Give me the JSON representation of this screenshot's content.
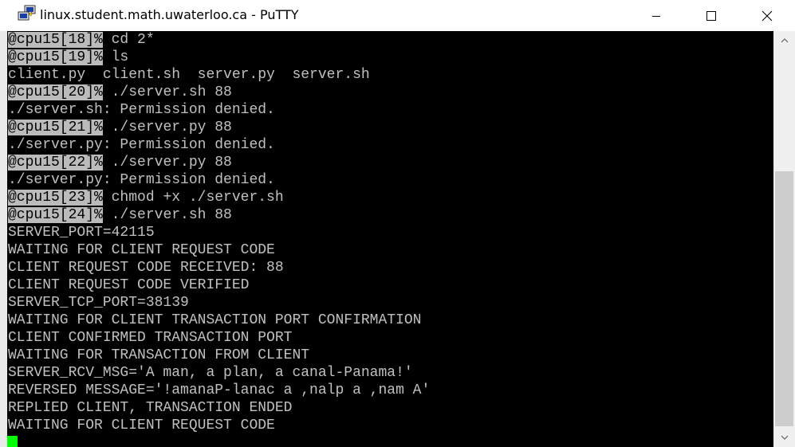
{
  "window": {
    "title": "linux.student.math.uwaterloo.ca - PuTTY",
    "icon": "putty-icon"
  },
  "terminal": {
    "lines": [
      {
        "prompt": "@cpu15[18]%",
        "text": " cd 2*"
      },
      {
        "prompt": "@cpu15[19]%",
        "text": " ls"
      },
      {
        "prompt": "",
        "text": "client.py  client.sh  server.py  server.sh"
      },
      {
        "prompt": "@cpu15[20]%",
        "text": " ./server.sh 88"
      },
      {
        "prompt": "",
        "text": "./server.sh: Permission denied."
      },
      {
        "prompt": "@cpu15[21]%",
        "text": " ./server.py 88"
      },
      {
        "prompt": "",
        "text": "./server.py: Permission denied."
      },
      {
        "prompt": "@cpu15[22]%",
        "text": " ./server.py 88"
      },
      {
        "prompt": "",
        "text": "./server.py: Permission denied."
      },
      {
        "prompt": "@cpu15[23]%",
        "text": " chmod +x ./server.sh"
      },
      {
        "prompt": "@cpu15[24]%",
        "text": " ./server.sh 88"
      },
      {
        "prompt": "",
        "text": "SERVER_PORT=42115"
      },
      {
        "prompt": "",
        "text": "WAITING FOR CLIENT REQUEST CODE"
      },
      {
        "prompt": "",
        "text": "CLIENT REQUEST CODE RECEIVED: 88"
      },
      {
        "prompt": "",
        "text": "CLIENT REQUEST CODE VERIFIED"
      },
      {
        "prompt": "",
        "text": "SERVER_TCP_PORT=38139"
      },
      {
        "prompt": "",
        "text": "WAITING FOR CLIENT TRANSACTION PORT CONFIRMATION"
      },
      {
        "prompt": "",
        "text": "CLIENT CONFIRMED TRANSACTION PORT"
      },
      {
        "prompt": "",
        "text": "WAITING FOR TRANSACTION FROM CLIENT"
      },
      {
        "prompt": "",
        "text": "SERVER_RCV_MSG='A man, a plan, a canal-Panama!'"
      },
      {
        "prompt": "",
        "text": "REVERSED MESSAGE='!amanaP-lanac a ,nalp a ,nam A'"
      },
      {
        "prompt": "",
        "text": "REPLIED CLIENT, TRANSACTION ENDED"
      },
      {
        "prompt": "",
        "text": "WAITING FOR CLIENT REQUEST CODE"
      }
    ],
    "colors": {
      "background": "#000000",
      "foreground": "#c0c0c0",
      "prompt_highlight": "#bbbbbb",
      "cursor": "#00ff00"
    }
  }
}
